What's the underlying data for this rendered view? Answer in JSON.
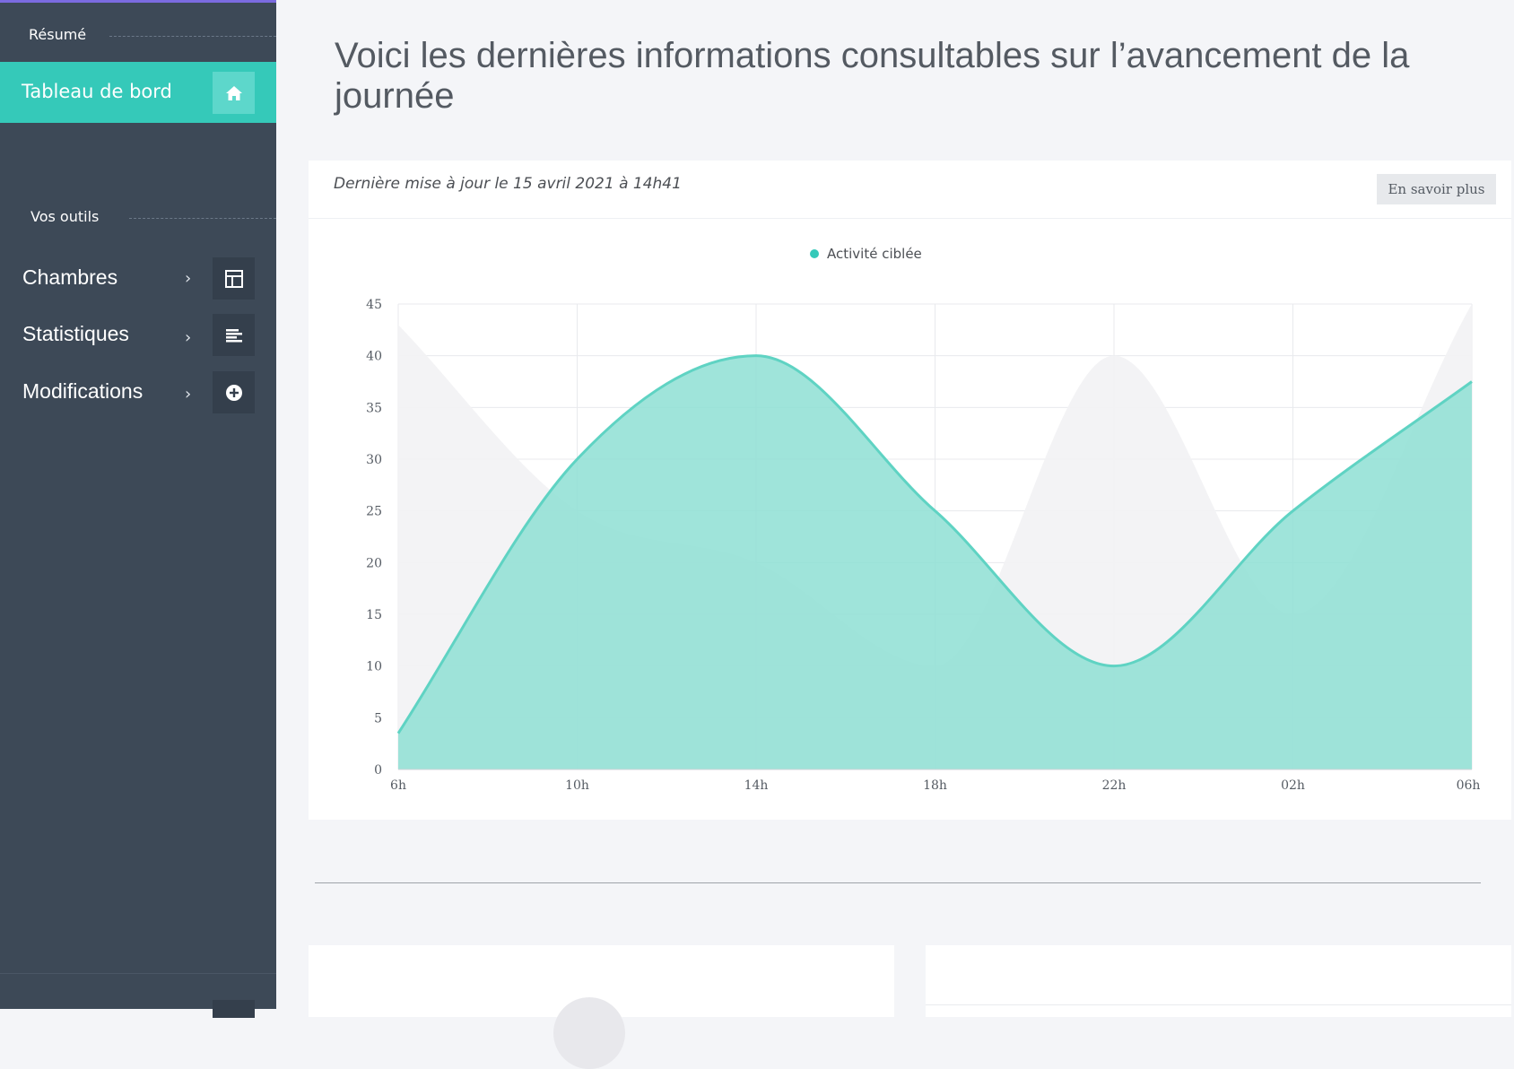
{
  "sidebar": {
    "summary_title": "Résumé",
    "dashboard": {
      "label": "Tableau de bord",
      "icon": "home-icon"
    },
    "tools_title": "Vos outils",
    "items": [
      {
        "label": "Chambres",
        "chevron": "›",
        "icon": "layout-icon"
      },
      {
        "label": "Statistiques",
        "chevron": "›",
        "icon": "align-left-icon"
      },
      {
        "label": "Modifications",
        "chevron": "›",
        "icon": "plus-circle-icon"
      }
    ]
  },
  "main": {
    "title": "Voici les dernières informations consultables sur l’avancement de la journée",
    "card": {
      "updated": "Dernière mise à jour le 15 avril 2021 à 14h41",
      "more_button": "En savoir plus"
    }
  },
  "colors": {
    "accent": "#35c9b9",
    "sidebar_bg": "#3d4957",
    "top_bar": "#7b6be0",
    "series_line": "#5fd3c3",
    "series_fill": "#8edfd3",
    "background_area": "#f2f2f4"
  },
  "chart_data": {
    "type": "area",
    "legend": [
      "Activité ciblée"
    ],
    "legend_position": "top-center",
    "x": [
      "6h",
      "10h",
      "14h",
      "18h",
      "22h",
      "02h",
      "06h"
    ],
    "ylim": [
      0,
      45
    ],
    "yticks": [
      0,
      5,
      10,
      15,
      20,
      25,
      30,
      35,
      40,
      45
    ],
    "grid": true,
    "series": [
      {
        "name": "Activité ciblée",
        "values": [
          3.5,
          30,
          40,
          25,
          10,
          25,
          37.5
        ]
      },
      {
        "values": [
          43,
          25,
          20,
          10,
          40,
          15,
          45
        ]
      }
    ]
  }
}
